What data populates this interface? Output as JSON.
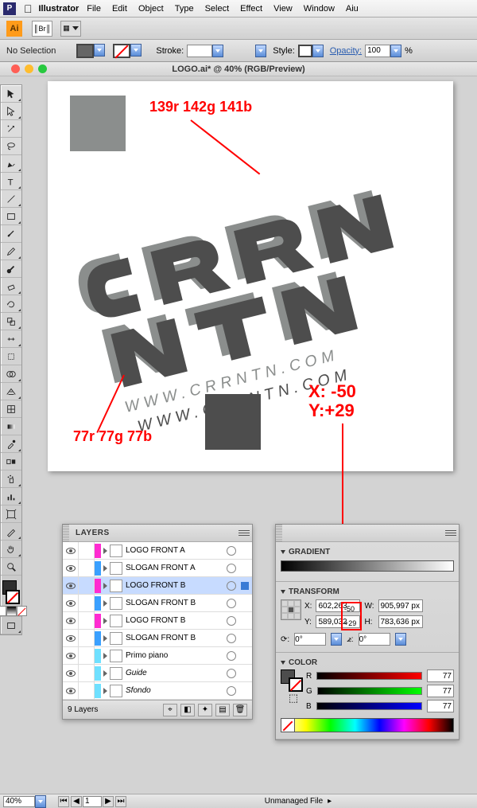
{
  "menubar": {
    "app_name": "Illustrator",
    "items": [
      "File",
      "Edit",
      "Object",
      "Type",
      "Select",
      "Effect",
      "View",
      "Window",
      "Aiu"
    ]
  },
  "control_bar": {
    "sel_label": "No Selection",
    "stroke_label": "Stroke:",
    "stroke_value": "",
    "style_label": "Style:",
    "opacity_label": "Opacity:",
    "opacity_value": "100",
    "opacity_unit": "%"
  },
  "document": {
    "title": "LOGO.ai* @ 40% (RGB/Preview)"
  },
  "annotations": {
    "color1": "139r 142g 141b",
    "color2": "77r 77g 77b",
    "xy": "X: -50\nY:+29"
  },
  "artwork": {
    "url_text_1": "WWW.CRRNTN.COM",
    "url_text_2": "WWW.CRRNTN.COM"
  },
  "layers_panel": {
    "title": "LAYERS",
    "items": [
      {
        "name": "LOGO FRONT A",
        "color": "#ff2bd1",
        "sel": false,
        "italic": false
      },
      {
        "name": "SLOGAN FRONT A",
        "color": "#3aa0ff",
        "sel": false,
        "italic": false
      },
      {
        "name": "LOGO FRONT B",
        "color": "#ff2bd1",
        "sel": true,
        "italic": false
      },
      {
        "name": "SLOGAN FRONT B",
        "color": "#3aa0ff",
        "sel": false,
        "italic": false
      },
      {
        "name": "LOGO FRONT B",
        "color": "#ff2bd1",
        "sel": false,
        "italic": false
      },
      {
        "name": "SLOGAN FRONT B",
        "color": "#3aa0ff",
        "sel": false,
        "italic": false
      },
      {
        "name": "Primo piano",
        "color": "#6fe0ff",
        "sel": false,
        "italic": false
      },
      {
        "name": "Guide",
        "color": "#6fe0ff",
        "sel": false,
        "italic": true
      },
      {
        "name": "Sfondo",
        "color": "#6fe0ff",
        "sel": false,
        "italic": true
      }
    ],
    "footer_text": "9 Layers"
  },
  "transform_panel": {
    "gradient_title": "GRADIENT",
    "transform_title": "TRANSFORM",
    "x_label": "X:",
    "x_value": "602,263",
    "y_label": "Y:",
    "y_value": "589,032",
    "w_label": "W:",
    "w_value": "905,997 px",
    "h_label": "H:",
    "h_value": "783,636 px",
    "rotate_value": "0°",
    "shear_value": "0°"
  },
  "color_panel": {
    "title": "COLOR",
    "r_label": "R",
    "r_value": "77",
    "g_label": "G",
    "g_value": "77",
    "b_label": "B",
    "b_value": "77"
  },
  "red_xy_hint": {
    "x": "-50",
    "y": "+29"
  },
  "statusbar": {
    "zoom": "40%",
    "page": "1",
    "status": "Unmanaged File"
  }
}
